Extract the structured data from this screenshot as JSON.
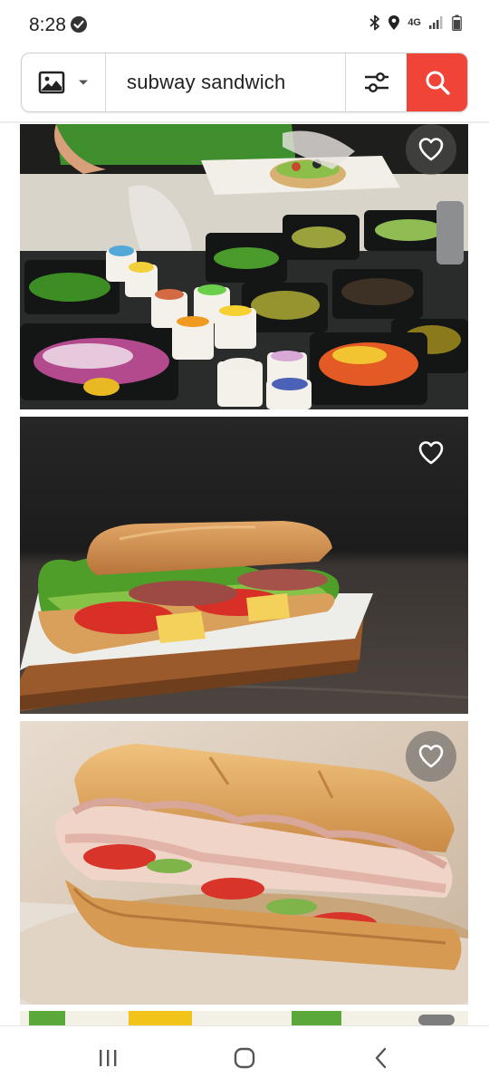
{
  "status": {
    "time": "8:28",
    "network": "4G",
    "icons": [
      "check-circle-icon",
      "bluetooth-icon",
      "location-icon",
      "signal-icon",
      "battery-icon"
    ]
  },
  "search": {
    "query": "subway sandwich",
    "image_search_icon": "image-icon",
    "dropdown_icon": "caret-down-icon",
    "filter_icon": "sliders-icon",
    "search_icon": "magnifier-icon",
    "accent": "#f04438"
  },
  "results": [
    {
      "id": "result-1",
      "subject": "sandwich counter with toppings",
      "favorite_icon": "heart-outline-icon"
    },
    {
      "id": "result-2",
      "subject": "sub sandwich on board",
      "favorite_icon": "heart-outline-icon"
    },
    {
      "id": "result-3",
      "subject": "ham sub sandwich",
      "favorite_icon": "heart-outline-icon"
    }
  ],
  "nav": {
    "icons": [
      "recents-icon",
      "home-icon",
      "back-icon"
    ]
  }
}
